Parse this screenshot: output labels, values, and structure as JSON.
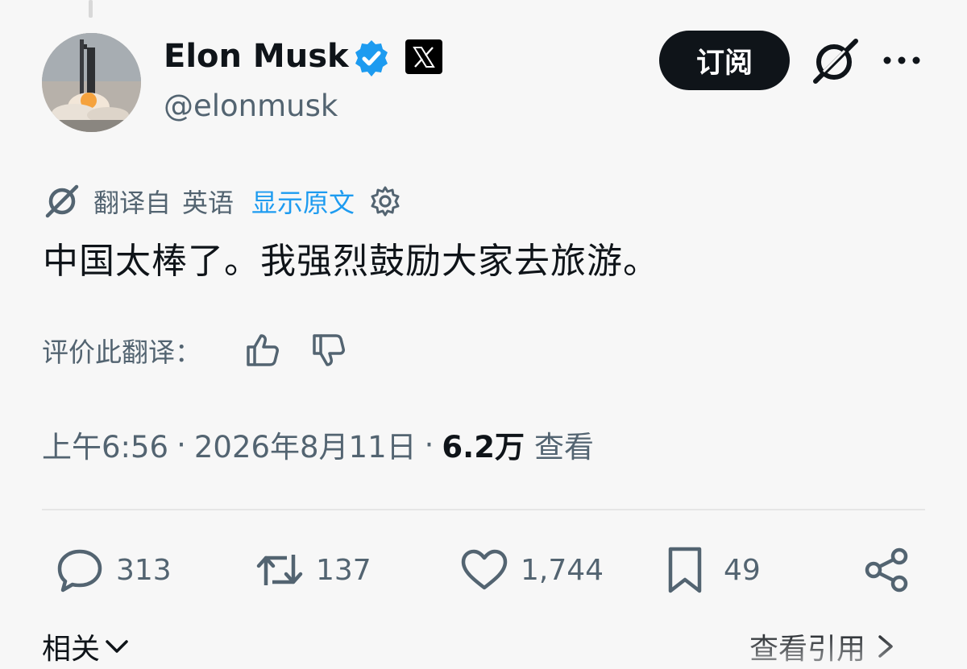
{
  "author": {
    "name": "Elon Musk",
    "handle": "@elonmusk",
    "verified_color": "#1d9bf0"
  },
  "header": {
    "subscribe_label": "订阅"
  },
  "translation": {
    "translated_from": "翻译自",
    "language": "英语",
    "show_original": "显示原文"
  },
  "tweet": {
    "text": "中国太棒了。我强烈鼓励大家去旅游。"
  },
  "rating": {
    "label": "评价此翻译："
  },
  "meta": {
    "time": "上午6:56",
    "date": "2026年8月11日",
    "views_count": "6.2万",
    "views_label": "查看",
    "separator": "·"
  },
  "actions": {
    "replies": "313",
    "retweets": "137",
    "likes": "1,744",
    "bookmarks": "49"
  },
  "footer": {
    "related_label": "相关",
    "quotes_label": "查看引用"
  },
  "colors": {
    "text": "#0f1419",
    "secondary": "#536471",
    "accent": "#1d9bf0",
    "background": "#f7f7f7"
  }
}
